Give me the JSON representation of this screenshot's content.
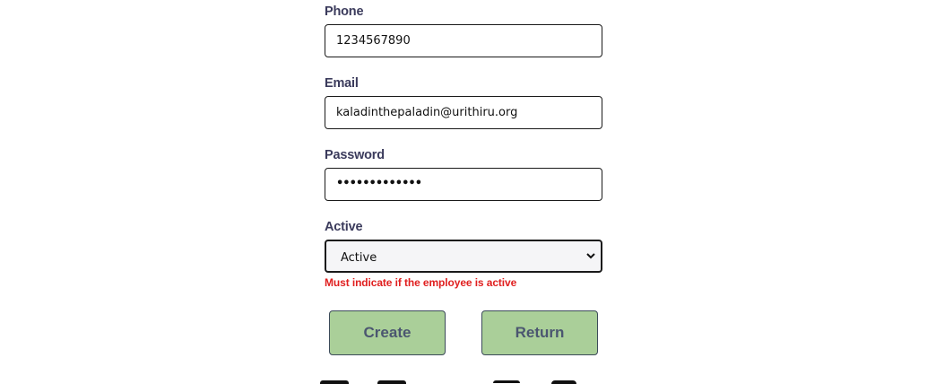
{
  "form": {
    "phone": {
      "label": "Phone",
      "value": "1234567890"
    },
    "email": {
      "label": "Email",
      "value": "kaladinthepaladin@urithiru.org"
    },
    "password": {
      "label": "Password",
      "value": "•••••••••••••"
    },
    "active": {
      "label": "Active",
      "selected": "Active",
      "error": "Must indicate if the employee is active"
    }
  },
  "buttons": {
    "create": "Create",
    "return": "Return"
  },
  "colors": {
    "button_bg": "#aacf99",
    "error": "#e02020",
    "label": "#3b3b5c"
  },
  "footer": {
    "icons": [
      "facebook-icon",
      "linkedin-icon",
      "instagram-icon",
      "github-icon"
    ]
  }
}
